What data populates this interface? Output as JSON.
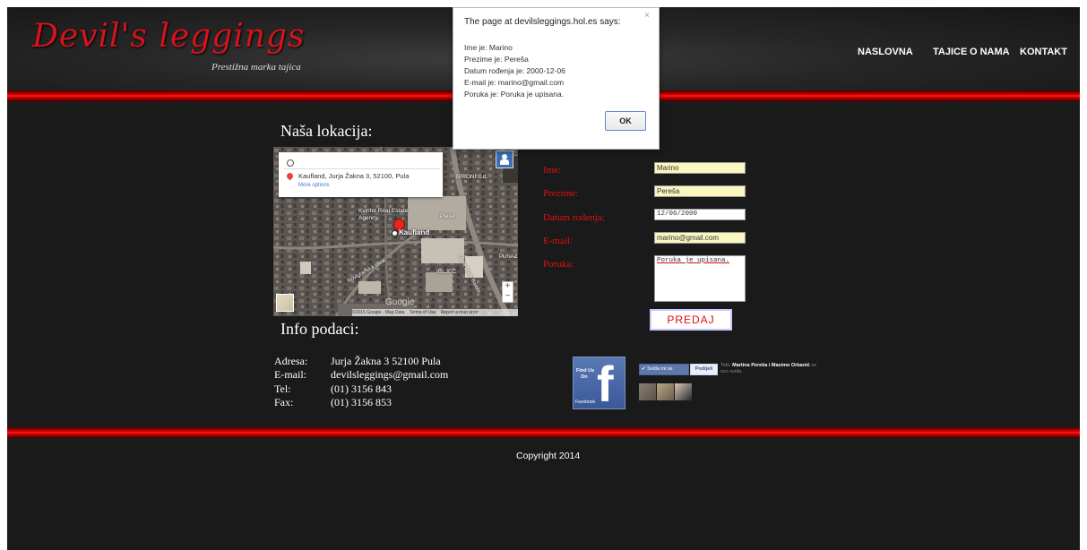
{
  "header": {
    "logo": "Devil's leggings",
    "tagline": "Prestižna marka tajica",
    "nav": [
      "NASLOVNA",
      "TAJICE",
      "O NAMA",
      "KONTAKT"
    ]
  },
  "location": {
    "title": "Naša lokacija:",
    "map": {
      "place": "Kaufland, Jurja Žakna 3, 52100, Pula",
      "more": "More options",
      "marker_label": "Kaufland",
      "labels": [
        "BRIONI d.d.",
        "Kvintet Real Estate Agency",
        "Pleter",
        "Ulica Mate Balote",
        "Novigradska ulica",
        "PUNAZ",
        "IBLJEC"
      ],
      "copyright": "©2015 Google · Map Data",
      "terms": "Terms of Use",
      "report": "Report a map error",
      "google": "Google"
    }
  },
  "form": {
    "fields": [
      {
        "label": "Ime:",
        "value": "Marino"
      },
      {
        "label": "Prezime:",
        "value": "Pereša"
      },
      {
        "label": "Datum rođenja:",
        "value": "12/06/2000"
      },
      {
        "label": "E-mail:",
        "value": "marino@gmail.com"
      },
      {
        "label": "Poruka:",
        "value": "Poruka je upisana."
      }
    ],
    "submit": "PREDAJ"
  },
  "info": {
    "title": "Info podaci:",
    "rows": [
      {
        "key": "Adresa:",
        "value": "Jurja Žakna 3 52100 Pula"
      },
      {
        "key": "E-mail:",
        "value": "devilsleggings@gmail.com"
      },
      {
        "key": "Tel:",
        "value": "(01) 3156 843"
      },
      {
        "key": "Fax:",
        "value": "(01) 3156 853"
      }
    ]
  },
  "facebook": {
    "badge_line1": "Find Us",
    "badge_line2": "On",
    "badge_bottom": "Facebook",
    "like": "Sviđa mi se",
    "share": "Podijeli",
    "text_you": "Tebi,",
    "friends": "Martina Pereša i Masimo Orbanić",
    "text_rest": "se ovo sviđa."
  },
  "footer": {
    "copyright": "Copyright 2014"
  },
  "dialog": {
    "title": "The page at devilsleggings.hol.es says:",
    "lines": [
      "Ime je: Marino",
      "Prezime je: Pereša",
      "Datum rođenja je: 2000-12-06",
      "E-mail je: marino@gmail.com",
      "Poruka je: Poruka je upisana."
    ],
    "ok": "OK",
    "close": "×"
  }
}
